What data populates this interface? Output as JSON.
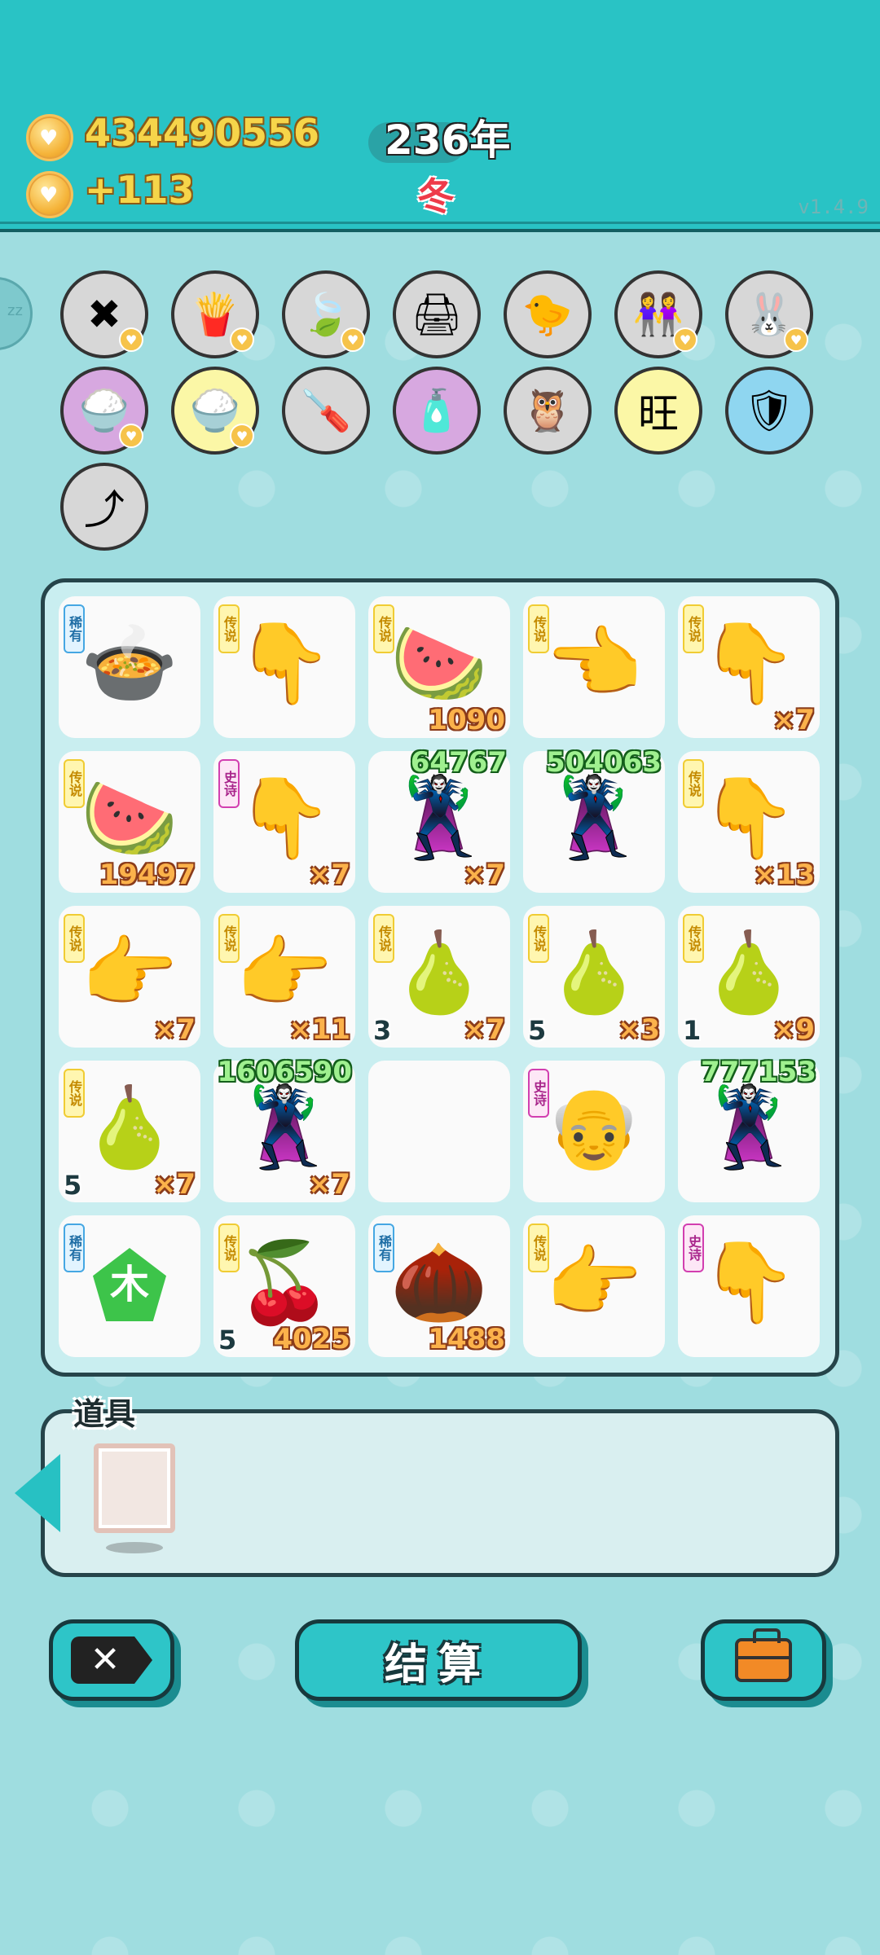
{
  "header": {
    "money": "434490556",
    "income": "+113",
    "year": "236年",
    "season": "冬",
    "version": "v1.4.9"
  },
  "relics": [
    {
      "name": "cancel-tag-icon",
      "glyph": "✖",
      "bg": "#d7d7d7",
      "heart": true
    },
    {
      "name": "fries-icon",
      "glyph": "🍟",
      "bg": "#d7d7d7",
      "heart": true
    },
    {
      "name": "leaf-icon",
      "glyph": "🍃",
      "bg": "#d7d7d7",
      "heart": true
    },
    {
      "name": "printer-icon",
      "glyph": "🖨",
      "bg": "#d7d7d7",
      "heart": false
    },
    {
      "name": "chick-icon",
      "glyph": "🐤",
      "bg": "#d7d7d7",
      "heart": false
    },
    {
      "name": "girls-icon",
      "glyph": "👭",
      "bg": "#d7d7d7",
      "heart": true
    },
    {
      "name": "rabbit-icon",
      "glyph": "🐰",
      "bg": "#d7d7d7",
      "heart": true
    },
    {
      "name": "rice-bowl-icon",
      "glyph": "🍚",
      "bg": "#d7a8e0",
      "heart": true
    },
    {
      "name": "rice-bowl-icon",
      "glyph": "🍚",
      "bg": "#fbf7a6",
      "heart": true
    },
    {
      "name": "screwdriver-icon",
      "glyph": "🪛",
      "bg": "#d7d7d7",
      "heart": false
    },
    {
      "name": "spray-bottle-icon",
      "glyph": "🧴",
      "bg": "#d7a8e0",
      "heart": false
    },
    {
      "name": "owls-icon",
      "glyph": "🦉",
      "bg": "#d7d7d7",
      "heart": false
    },
    {
      "name": "wang-text-icon",
      "glyph": "旺",
      "bg": "#fbf7a6",
      "heart": false
    },
    {
      "name": "shield-icon",
      "glyph": "🛡",
      "bg": "#8fd6f0",
      "heart": false
    },
    {
      "name": "arrow-up-icon",
      "glyph": "⤴",
      "bg": "#d7d7d7",
      "heart": false
    }
  ],
  "grid": [
    [
      {
        "icon": "🍲",
        "name": "pressure-cooker-icon",
        "badge": "稀有",
        "badge_type": "rare",
        "br": "",
        "bl": "",
        "top": ""
      },
      {
        "icon": "👇",
        "name": "hand-pointer-icon",
        "badge": "传说",
        "badge_type": "legend",
        "br": "",
        "bl": "",
        "top": ""
      },
      {
        "icon": "🍉",
        "name": "watermelon-icon",
        "badge": "传说",
        "badge_type": "legend",
        "br": "1090",
        "bl": "",
        "top": ""
      },
      {
        "icon": "👈",
        "name": "hand-pointer-icon",
        "badge": "传说",
        "badge_type": "legend",
        "br": "",
        "bl": "",
        "top": ""
      },
      {
        "icon": "👇",
        "name": "hand-pointer-icon",
        "badge": "传说",
        "badge_type": "legend",
        "br": "×7",
        "bl": "",
        "top": ""
      }
    ],
    [
      {
        "icon": "🍉",
        "name": "watermelon-icon",
        "badge": "传说",
        "badge_type": "legend",
        "br": "19497",
        "bl": "",
        "top": ""
      },
      {
        "icon": "👇",
        "name": "hand-pointer-icon",
        "badge": "史诗",
        "badge_type": "epic",
        "br": "×7",
        "bl": "",
        "top": ""
      },
      {
        "icon": "🦹",
        "name": "thief-icon",
        "badge": "",
        "badge_type": "",
        "br": "×7",
        "bl": "",
        "top": "64767"
      },
      {
        "icon": "🦹",
        "name": "thief-icon",
        "badge": "",
        "badge_type": "",
        "br": "",
        "bl": "",
        "top": "504063"
      },
      {
        "icon": "👇",
        "name": "hand-pointer-icon",
        "badge": "传说",
        "badge_type": "legend",
        "br": "×13",
        "bl": "",
        "top": ""
      }
    ],
    [
      {
        "icon": "👉",
        "name": "hand-pointer-icon",
        "badge": "传说",
        "badge_type": "legend",
        "br": "×7",
        "bl": "",
        "top": ""
      },
      {
        "icon": "👉",
        "name": "hand-pointer-icon",
        "badge": "传说",
        "badge_type": "legend",
        "br": "×11",
        "bl": "",
        "top": ""
      },
      {
        "icon": "🍐",
        "name": "pear-icon",
        "badge": "传说",
        "badge_type": "legend",
        "br": "×7",
        "bl": "3",
        "top": ""
      },
      {
        "icon": "🍐",
        "name": "pear-icon",
        "badge": "传说",
        "badge_type": "legend",
        "br": "×3",
        "bl": "5",
        "top": ""
      },
      {
        "icon": "🍐",
        "name": "pear-icon",
        "badge": "传说",
        "badge_type": "legend",
        "br": "×9",
        "bl": "1",
        "top": ""
      }
    ],
    [
      {
        "icon": "🍐",
        "name": "pear-icon",
        "badge": "传说",
        "badge_type": "legend",
        "br": "×7",
        "bl": "5",
        "top": ""
      },
      {
        "icon": "🦹",
        "name": "thief-icon",
        "badge": "",
        "badge_type": "",
        "br": "×7",
        "bl": "",
        "top": "1606590"
      },
      {
        "icon": "",
        "name": "empty-slot",
        "badge": "",
        "badge_type": "",
        "br": "",
        "bl": "",
        "top": ""
      },
      {
        "icon": "👴",
        "name": "farmer-icon",
        "badge": "史诗",
        "badge_type": "epic",
        "br": "",
        "bl": "",
        "top": ""
      },
      {
        "icon": "🦹",
        "name": "thief-icon",
        "badge": "",
        "badge_type": "",
        "br": "",
        "bl": "",
        "top": "777153"
      }
    ],
    [
      {
        "icon": "木",
        "name": "wood-element-icon",
        "badge": "稀有",
        "badge_type": "rare",
        "br": "",
        "bl": "",
        "top": ""
      },
      {
        "icon": "🍒",
        "name": "longan-icon",
        "badge": "传说",
        "badge_type": "legend",
        "br": "4025",
        "bl": "5",
        "top": ""
      },
      {
        "icon": "🌰",
        "name": "nut-icon",
        "badge": "稀有",
        "badge_type": "rare",
        "br": "1488",
        "bl": "",
        "top": ""
      },
      {
        "icon": "👉",
        "name": "hand-pointer-icon",
        "badge": "传说",
        "badge_type": "legend",
        "br": "",
        "bl": "",
        "top": ""
      },
      {
        "icon": "👇",
        "name": "hand-pointer-icon",
        "badge": "史诗",
        "badge_type": "epic",
        "br": "",
        "bl": "",
        "top": ""
      }
    ]
  ],
  "items": {
    "title": "道具"
  },
  "buttons": {
    "cancel": "✕",
    "settle": "结算"
  }
}
